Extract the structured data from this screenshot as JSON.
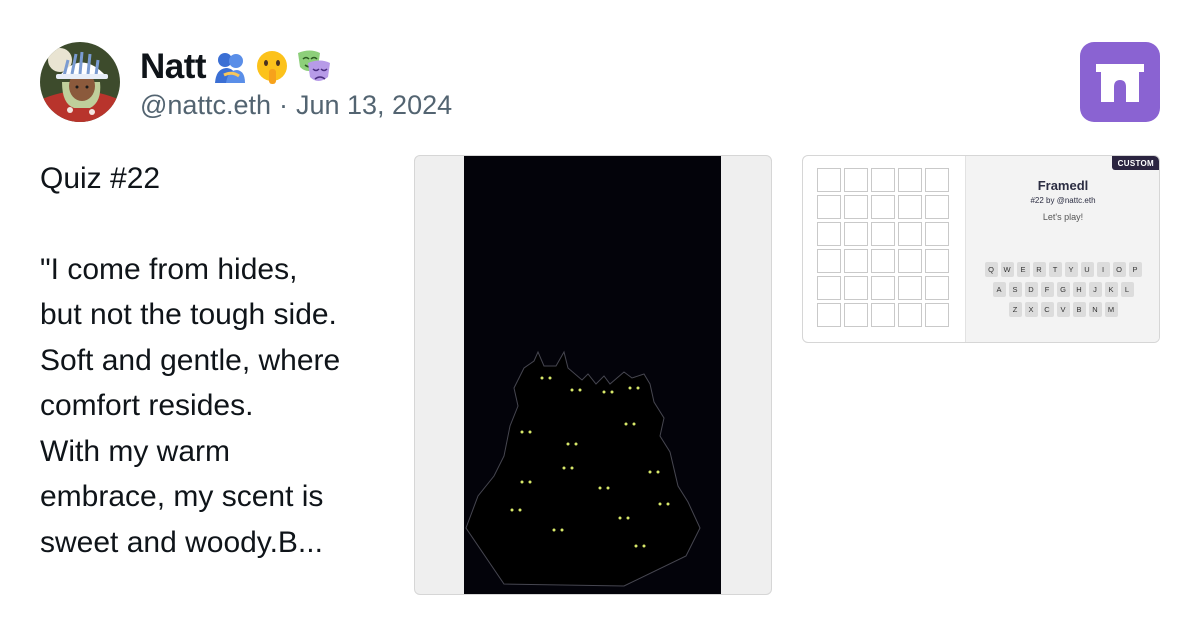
{
  "post": {
    "author_name": "Natt",
    "name_emojis": [
      "people-hugging-emoji",
      "shushing-face-emoji",
      "performing-arts-emoji"
    ],
    "handle": "@nattc.eth",
    "separator": "·",
    "date": "Jun 13, 2024",
    "text_lines": {
      "title": "Quiz #22",
      "l1": "\"I come from hides,",
      "l2": "but not the tough side.",
      "l3": "Soft and gentle, where",
      "l4": "comfort resides.",
      "l5": "With my warm",
      "l6": "embrace, my scent is",
      "l7": "sweet and woody.B..."
    }
  },
  "brand_icon": "arch-icon",
  "brand_color": "#8a63d2",
  "image_embed": {
    "icon": "black-cats-illustration",
    "background": "#03030a",
    "eye_color": "#d8e86a"
  },
  "frame_embed": {
    "badge": "CUSTOM",
    "title": "Framedl",
    "subtitle": "#22 by @nattc.eth",
    "prompt": "Let's play!",
    "grid_rows": 6,
    "grid_cols": 5,
    "keyboard": {
      "row1": [
        "Q",
        "W",
        "E",
        "R",
        "T",
        "Y",
        "U",
        "I",
        "O",
        "P"
      ],
      "row2": [
        "A",
        "S",
        "D",
        "F",
        "G",
        "H",
        "J",
        "K",
        "L"
      ],
      "row3": [
        "Z",
        "X",
        "C",
        "V",
        "B",
        "N",
        "M"
      ]
    }
  }
}
